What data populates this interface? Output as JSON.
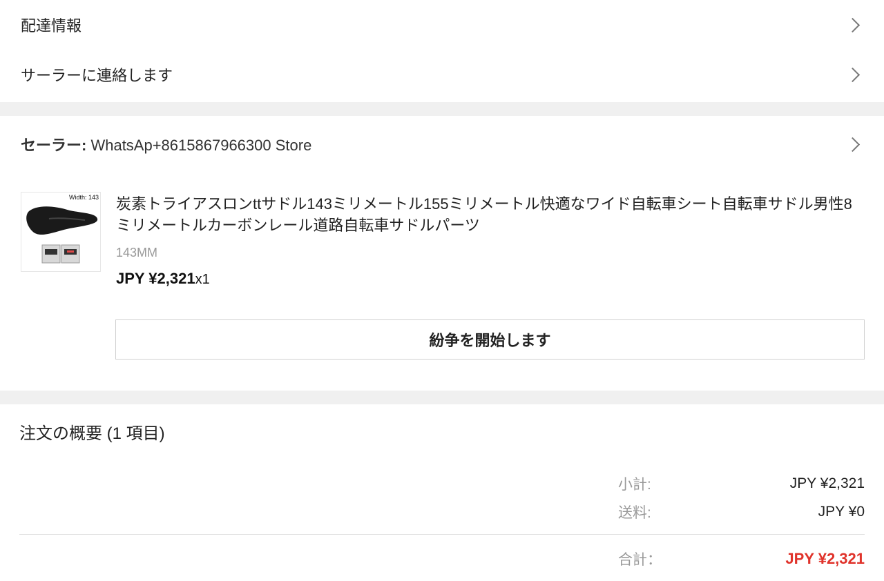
{
  "nav": {
    "delivery_info": "配達情報",
    "contact_seller": "サーラーに連絡します"
  },
  "seller": {
    "prefix": "セーラー:",
    "name": "WhatsAp+8615867966300 Store"
  },
  "product": {
    "image_caption": "Width: 143",
    "title": "炭素トライアスロンttサドル143ミリメートル155ミリメートル快適なワイド自転車シート自転車サドル男性8ミリメートルカーボンレール道路自転車サドルパーツ",
    "variant": "143MM",
    "price": "JPY ¥2,321",
    "quantity": "x1"
  },
  "actions": {
    "dispute_label": "紛争を開始します"
  },
  "summary": {
    "title": "注文の概要 (1 項目)",
    "subtotal_label": "小計:",
    "subtotal_value": "JPY ¥2,321",
    "shipping_label": "送料:",
    "shipping_value": "JPY ¥0",
    "total_label": "合計：",
    "total_value": "JPY ¥2,321"
  },
  "colors": {
    "total_accent": "#e0332b",
    "section_gap": "#f0f0f0"
  }
}
